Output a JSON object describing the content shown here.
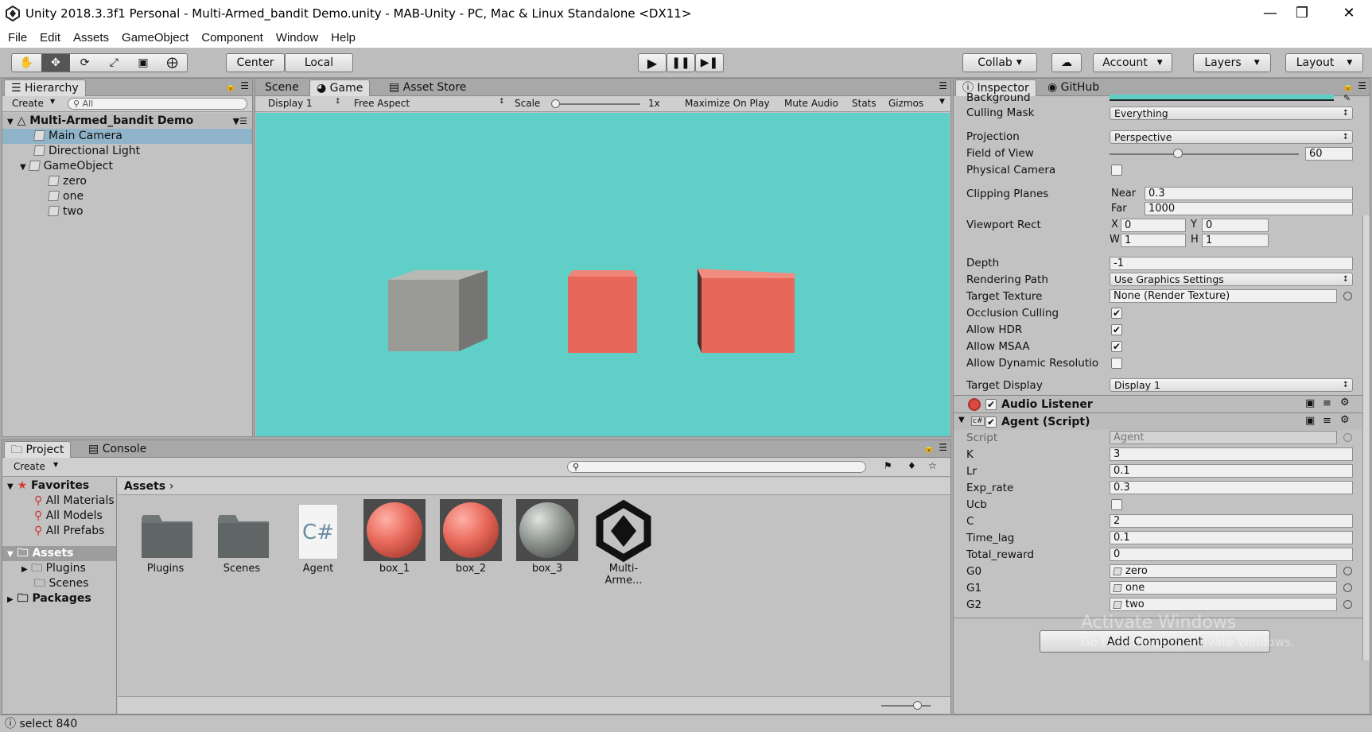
{
  "window": {
    "title": "Unity 2018.3.3f1 Personal - Multi-Armed_bandit Demo.unity - MAB-Unity - PC, Mac & Linux Standalone <DX11>",
    "minimize": "—",
    "maximize": "❐",
    "close": "✕"
  },
  "menu": [
    "File",
    "Edit",
    "Assets",
    "GameObject",
    "Component",
    "Window",
    "Help"
  ],
  "toolbar": {
    "center": "Center",
    "local": "Local",
    "collab": "Collab",
    "account": "Account",
    "layers": "Layers",
    "layout": "Layout"
  },
  "hierarchy": {
    "tab": "Hierarchy",
    "create": "Create",
    "search_placeholder": "All",
    "scene": "Multi-Armed_bandit Demo",
    "items": [
      "Main Camera",
      "Directional Light",
      "GameObject",
      "zero",
      "one",
      "two"
    ]
  },
  "game": {
    "tabs": [
      "Scene",
      "Game",
      "Asset Store"
    ],
    "display": "Display 1",
    "aspect": "Free Aspect",
    "scale_label": "Scale",
    "scale_value": "1x",
    "maximize": "Maximize On Play",
    "mute": "Mute Audio",
    "stats": "Stats",
    "gizmos": "Gizmos",
    "bg_color": "#5fcfc8",
    "cube_colors": [
      "#9a9a97",
      "#e7685a",
      "#e7685a"
    ]
  },
  "project": {
    "tabs": [
      "Project",
      "Console"
    ],
    "create": "Create",
    "favorites": "Favorites",
    "fav_items": [
      "All Materials",
      "All Models",
      "All Prefabs"
    ],
    "assets_root": "Assets",
    "asset_folders": [
      "Plugins",
      "Scenes"
    ],
    "packages": "Packages",
    "breadcrumb": "Assets",
    "items": [
      "Plugins",
      "Scenes",
      "Agent",
      "box_1",
      "box_2",
      "box_3",
      "Multi-Arme..."
    ],
    "cs_label": "C#"
  },
  "inspector": {
    "tabs": [
      "Inspector",
      "GitHub"
    ],
    "background": "Background",
    "culling_mask": "Culling Mask",
    "culling_value": "Everything",
    "projection": "Projection",
    "projection_value": "Perspective",
    "fov": "Field of View",
    "fov_value": "60",
    "physical": "Physical Camera",
    "clipping": "Clipping Planes",
    "near_label": "Near",
    "near": "0.3",
    "far_label": "Far",
    "far": "1000",
    "viewport": "Viewport Rect",
    "vx_label": "X",
    "vx": "0",
    "vy_label": "Y",
    "vy": "0",
    "vw_label": "W",
    "vw": "1",
    "vh_label": "H",
    "vh": "1",
    "depth": "Depth",
    "depth_value": "-1",
    "rendering": "Rendering Path",
    "rendering_value": "Use Graphics Settings",
    "target_tex": "Target Texture",
    "target_tex_value": "None (Render Texture)",
    "occlusion": "Occlusion Culling",
    "hdr": "Allow HDR",
    "msaa": "Allow MSAA",
    "dynres": "Allow Dynamic Resolutio",
    "target_display": "Target Display",
    "target_display_value": "Display 1",
    "audio_listener": "Audio Listener",
    "agent_script": "Agent (Script)",
    "script_label": "Script",
    "script_value": "Agent",
    "fields": [
      {
        "label": "K",
        "value": "3"
      },
      {
        "label": "Lr",
        "value": "0.1"
      },
      {
        "label": "Exp_rate",
        "value": "0.3"
      },
      {
        "label": "Ucb",
        "value": ""
      },
      {
        "label": "C",
        "value": "2"
      },
      {
        "label": "Time_lag",
        "value": "0.1"
      },
      {
        "label": "Total_reward",
        "value": "0"
      },
      {
        "label": "G0",
        "value": "zero"
      },
      {
        "label": "G1",
        "value": "one"
      },
      {
        "label": "G2",
        "value": "two"
      }
    ],
    "add_component": "Add Component",
    "watermark1": "Activate Windows",
    "watermark2": "Go to Settings to activate Windows."
  },
  "status": "select 840",
  "icons": [
    "unity-logo-icon",
    "hand-tool-icon",
    "move-tool-icon",
    "rotate-tool-icon",
    "scale-tool-icon",
    "rect-tool-icon",
    "transform-tool-icon",
    "play-icon",
    "pause-icon",
    "step-icon",
    "cloud-icon",
    "lock-icon",
    "menu-icon",
    "search-icon",
    "star-icon",
    "folder-icon",
    "checkbox-icon",
    "gear-icon",
    "help-icon"
  ]
}
